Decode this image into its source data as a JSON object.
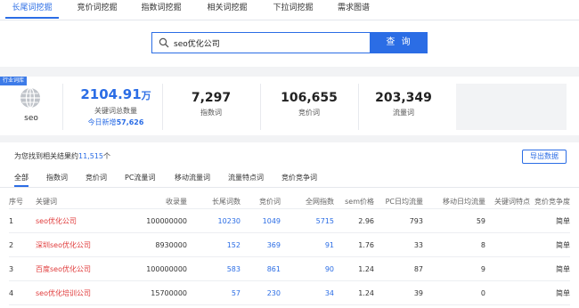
{
  "nav": {
    "tabs": [
      {
        "label": "长尾词挖掘",
        "active": true
      },
      {
        "label": "竞价词挖掘"
      },
      {
        "label": "指数词挖掘"
      },
      {
        "label": "相关词挖掘"
      },
      {
        "label": "下拉词挖掘"
      },
      {
        "label": "需求图谱"
      }
    ]
  },
  "search": {
    "value": "seo优化公司",
    "button_label": "查 询"
  },
  "stats": {
    "badge": "行业词库",
    "keyword": "seo",
    "total": {
      "value": "2104.91",
      "unit": "万",
      "label": "关键词总数量",
      "today_label": "今日新增",
      "today_value": "57,626"
    },
    "items": [
      {
        "value": "7,297",
        "label": "指数词"
      },
      {
        "value": "106,655",
        "label": "竞价词"
      },
      {
        "value": "203,349",
        "label": "流量词"
      }
    ]
  },
  "results": {
    "prefix": "为您找到相关结果约",
    "count": "11,515",
    "suffix": "个",
    "export_label": "导出数据"
  },
  "subtabs": [
    "全部",
    "指数词",
    "竞价词",
    "PC流量词",
    "移动流量词",
    "流量特点词",
    "竞价竞争词"
  ],
  "table": {
    "headers": [
      "序号",
      "关键词",
      "收录量",
      "长尾词数",
      "竞价词",
      "全网指数",
      "sem价格",
      "PC日均流量",
      "移动日均流量",
      "关键词特点",
      "竞价竞争度"
    ],
    "rows": [
      {
        "idx": "1",
        "keyword": "seo优化公司",
        "index_count": "100000000",
        "longtail": "10230",
        "bid": "1049",
        "net_index": "5715",
        "sem": "2.96",
        "pc": "793",
        "mobile": "59",
        "feature": "",
        "competition": "简单"
      },
      {
        "idx": "2",
        "keyword": "深圳seo优化公司",
        "index_count": "8930000",
        "longtail": "152",
        "bid": "369",
        "net_index": "91",
        "sem": "1.76",
        "pc": "33",
        "mobile": "8",
        "feature": "",
        "competition": "简单"
      },
      {
        "idx": "3",
        "keyword": "百度seo优化公司",
        "index_count": "100000000",
        "longtail": "583",
        "bid": "861",
        "net_index": "90",
        "sem": "1.24",
        "pc": "87",
        "mobile": "9",
        "feature": "",
        "competition": "简单"
      },
      {
        "idx": "4",
        "keyword": "seo优化培训公司",
        "index_count": "15700000",
        "longtail": "57",
        "bid": "230",
        "net_index": "34",
        "sem": "1.24",
        "pc": "39",
        "mobile": "0",
        "feature": "",
        "competition": "简单"
      }
    ]
  },
  "colors": {
    "accent": "#2b6de5",
    "keyword_link": "#e03a3a"
  }
}
